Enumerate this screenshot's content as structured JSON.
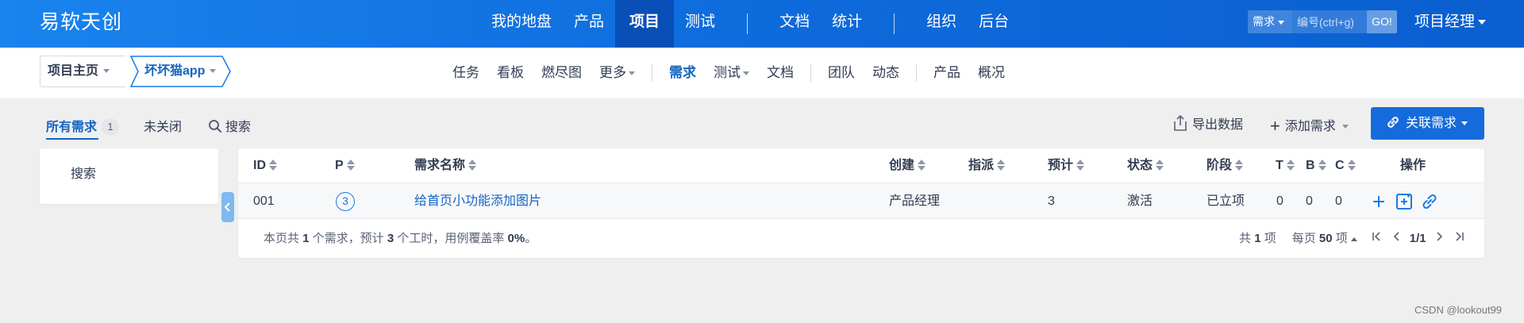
{
  "header": {
    "brand": "易软天创",
    "nav": [
      "我的地盘",
      "产品",
      "项目",
      "测试",
      "文档",
      "统计",
      "组织",
      "后台"
    ],
    "active_nav": "项目",
    "search": {
      "type": "需求",
      "placeholder": "编号(ctrl+g)",
      "go": "GO!"
    },
    "user": "项目经理"
  },
  "subheader": {
    "crumb_home": "项目主页",
    "crumb_project": "坏坏猫app",
    "nav": [
      "任务",
      "看板",
      "燃尽图",
      "更多",
      "需求",
      "测试",
      "文档",
      "团队",
      "动态",
      "产品",
      "概况"
    ],
    "active": "需求"
  },
  "filter": {
    "all_label": "所有需求",
    "all_count": "1",
    "unclosed_label": "未关闭",
    "search_label": "搜索",
    "export_label": "导出数据",
    "add_label": "添加需求",
    "link_label": "关联需求"
  },
  "side": {
    "search_label": "搜索"
  },
  "table": {
    "columns": [
      "ID",
      "P",
      "需求名称",
      "创建",
      "指派",
      "预计",
      "状态",
      "阶段",
      "T",
      "B",
      "C",
      "操作"
    ],
    "rows": [
      {
        "id": "001",
        "priority": "3",
        "title": "给首页小功能添加图片",
        "creator": "产品经理",
        "assignee": "",
        "estimate": "3",
        "status": "激活",
        "stage": "已立项",
        "t": "0",
        "b": "0",
        "c": "0"
      }
    ],
    "footer": {
      "p1": "本页共 ",
      "count": "1",
      "p2": " 个需求，预计 ",
      "hours": "3",
      "p3": " 个工时，用例覆盖率 ",
      "coverage": "0%",
      "p4": "。"
    },
    "pager": {
      "total_pre": "共",
      "total": "1",
      "total_post": "项",
      "per_pre": "每页",
      "per": "50",
      "per_post": "项",
      "page": "1/1"
    }
  },
  "watermark": "CSDN @lookout99"
}
